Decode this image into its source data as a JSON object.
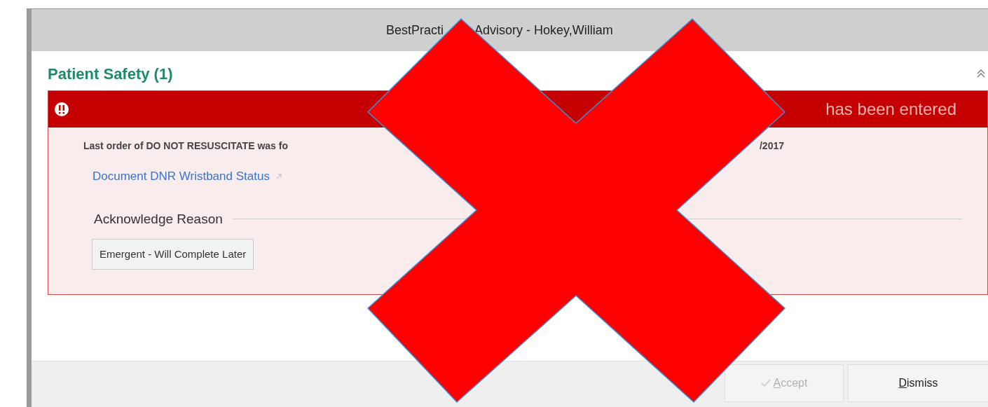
{
  "window": {
    "title_visible_parts": [
      "BestPracti",
      "Advisory  - Hokey,William"
    ]
  },
  "section": {
    "title": "Patient Safety (1)",
    "expanded": true
  },
  "alert": {
    "banner_text": "has been entered",
    "message_visible_parts": [
      "Last order of DO NOT RESUSCITATE was fo",
      "/2017"
    ],
    "link": "Document DNR Wristband Status",
    "reason_heading": "Acknowledge Reason",
    "reasons": [
      {
        "label": "Emergent - Will Complete Later",
        "selected": false
      }
    ]
  },
  "buttons": [
    {
      "label": "Accept",
      "disabled": true
    },
    {
      "label": "Dismiss",
      "disabled": false
    }
  ]
}
